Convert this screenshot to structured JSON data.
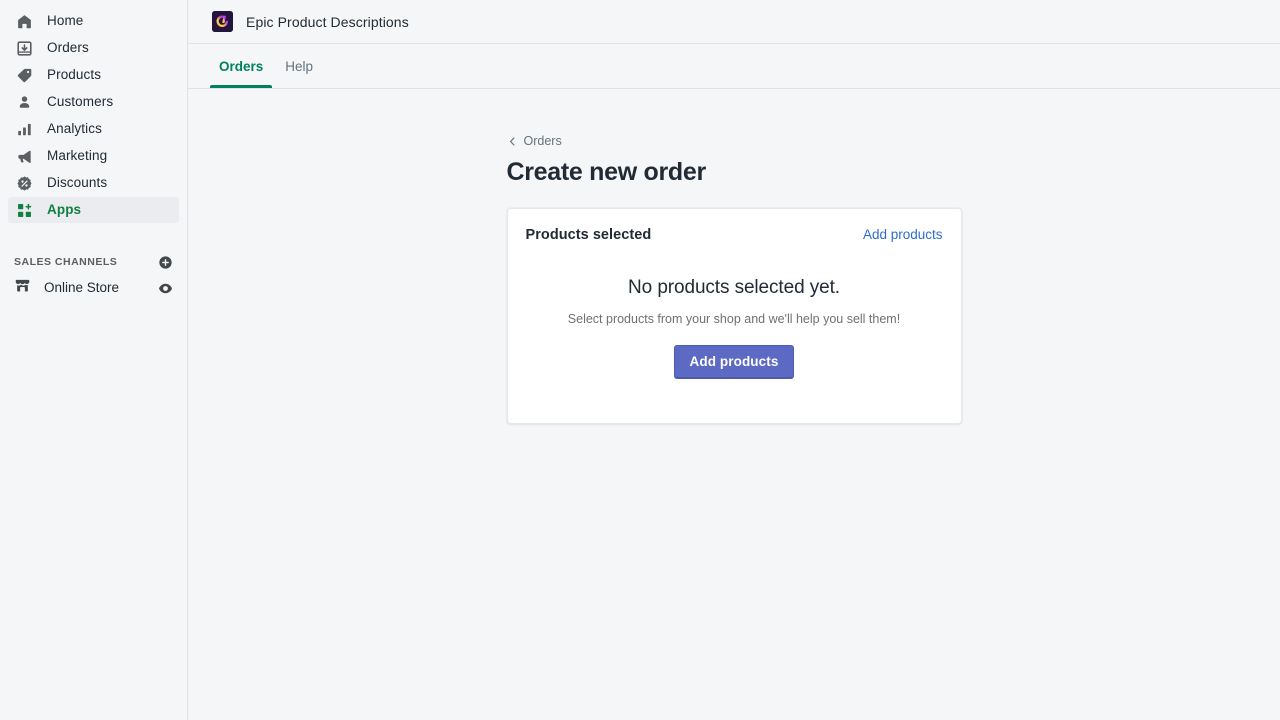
{
  "sidebar": {
    "items": [
      {
        "label": "Home",
        "icon": "home-icon",
        "active": false
      },
      {
        "label": "Orders",
        "icon": "orders-icon",
        "active": false
      },
      {
        "label": "Products",
        "icon": "products-icon",
        "active": false
      },
      {
        "label": "Customers",
        "icon": "customers-icon",
        "active": false
      },
      {
        "label": "Analytics",
        "icon": "analytics-icon",
        "active": false
      },
      {
        "label": "Marketing",
        "icon": "marketing-icon",
        "active": false
      },
      {
        "label": "Discounts",
        "icon": "discounts-icon",
        "active": false
      },
      {
        "label": "Apps",
        "icon": "apps-icon",
        "active": true
      }
    ],
    "sales_channels": {
      "title": "SALES CHANNELS",
      "add_icon": "circle-plus-icon",
      "items": [
        {
          "label": "Online Store",
          "icon": "storefront-icon",
          "action_icon": "eye-icon"
        }
      ]
    },
    "active_color": "#108043"
  },
  "header": {
    "app_icon": "epic-product-descriptions-logo",
    "app_title": "Epic Product Descriptions"
  },
  "tabs": {
    "active_color": "#008060",
    "items": [
      {
        "label": "Orders",
        "active": true
      },
      {
        "label": "Help",
        "active": false
      }
    ]
  },
  "page": {
    "breadcrumb_label": "Orders",
    "breadcrumb_icon": "chevron-left-icon",
    "title": "Create new order"
  },
  "card": {
    "title": "Products selected",
    "link_label": "Add products",
    "link_color": "#2c6ecb",
    "empty_title": "No products selected yet.",
    "empty_subtitle": "Select products from your shop and we'll help you sell them!",
    "primary_button_label": "Add products",
    "primary_button_color": "#5c6ac4"
  }
}
